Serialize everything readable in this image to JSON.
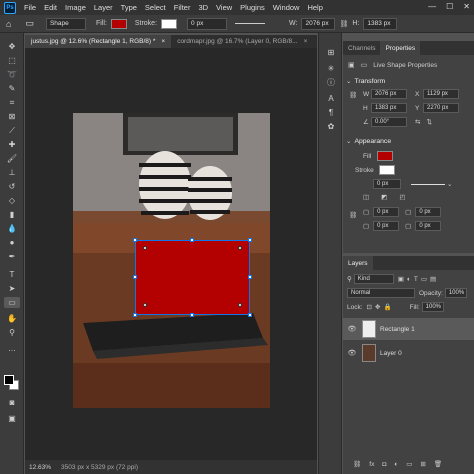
{
  "app": {
    "logo": "Ps"
  },
  "menu": [
    "File",
    "Edit",
    "Image",
    "Layer",
    "Type",
    "Select",
    "Filter",
    "3D",
    "View",
    "Plugins",
    "Window",
    "Help"
  ],
  "window_controls": {
    "minimize": "—",
    "maximize": "☐",
    "close": "✕"
  },
  "options": {
    "mode": "Shape",
    "fill_label": "Fill:",
    "fill_color": "#b30000",
    "stroke_label": "Stroke:",
    "stroke_width": "0 px",
    "w_label": "W:",
    "w_value": "2076 px",
    "h_label": "H:",
    "h_value": "1383 px"
  },
  "tabs": [
    {
      "label": "justus.jpg @ 12.6% (Rectangle 1, RGB/8) *",
      "close": "×"
    },
    {
      "label": "cordmapr.jpg @ 16.7% (Layer 0, RGB/8...",
      "close": "×"
    }
  ],
  "status": {
    "zoom": "12.63%",
    "info": "3503 px x 5329 px (72 ppi)"
  },
  "panel_tabs": [
    "Channels",
    "Properties"
  ],
  "properties": {
    "live_shape": "Live Shape Properties",
    "transform": "Transform",
    "w_label": "W",
    "w": "2076 px",
    "x_label": "X",
    "x": "1129 px",
    "h_label": "H",
    "h": "1383 px",
    "y_label": "Y",
    "y": "2270 px",
    "angle": "0.00°",
    "appearance": "Appearance",
    "fill_label": "Fill",
    "fill_color": "#b30000",
    "stroke_label": "Stroke",
    "stroke_width": "0 px",
    "corner_tl": "0 px",
    "corner_tr": "0 px",
    "corner_bl": "0 px",
    "corner_br": "0 px"
  },
  "layers": {
    "tab": "Layers",
    "kind": "Kind",
    "blend": "Normal",
    "opacity_label": "Opacity:",
    "opacity": "100%",
    "fill_label": "Fill:",
    "fill": "100%",
    "lock_label": "Lock:",
    "items": [
      {
        "name": "Rectangle 1"
      },
      {
        "name": "Layer 0"
      }
    ]
  },
  "colors": {
    "accent": "#1473e6",
    "shape_fill": "#b30000"
  }
}
